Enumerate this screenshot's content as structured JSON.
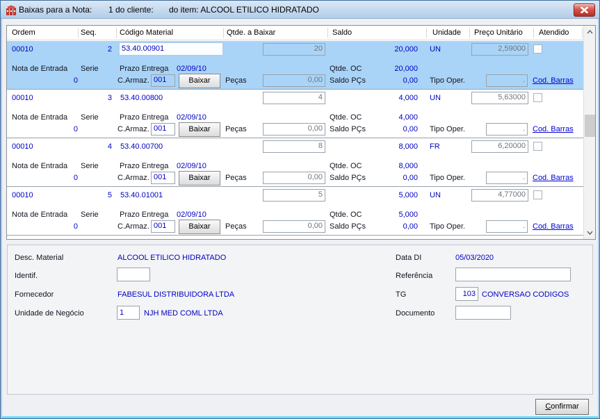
{
  "window": {
    "title_part1": "Baixas para a Nota:",
    "title_part2": "1 do cliente:",
    "title_part3": "do item: ALCOOL ETILICO HIDRATADO"
  },
  "colors": {
    "selected_row": "#a9d4f7",
    "value_text": "#0000c0",
    "link": "#0000d6",
    "titlebar": "#b2cde9",
    "close_button": "#c23b32"
  },
  "table": {
    "headers": [
      "Ordem",
      "Seq.",
      "Código Material",
      "Qtde. a  Baixar",
      "Saldo",
      "Unidade",
      "Preço Unitário",
      "Atendido"
    ],
    "labels": {
      "nota": "Nota de Entrada",
      "serie": "Serie",
      "prazo": "Prazo Entrega",
      "qtde_oc": "Qtde. OC",
      "c_armaz": "C.Armaz.",
      "baixar": "Baixar",
      "pecas": "Peças",
      "saldo_pcs": "Saldo PÇs",
      "tipo_oper": "Tipo Oper.",
      "cod_barras": "Cod. Barras"
    },
    "rows": [
      {
        "selected": true,
        "ordem": "00010",
        "seq": "2",
        "codigo": "53.40.00901",
        "qtde": "20",
        "saldo": "20,000",
        "unidade": "UN",
        "preco": "2,59000",
        "prazo_date": "02/09/10",
        "qtde_oc": "20,000",
        "zero": "0",
        "armazem": "001",
        "pecas_val": "0,00",
        "saldo_pcs_val": "0,00",
        "tipo_val": "."
      },
      {
        "selected": false,
        "ordem": "00010",
        "seq": "3",
        "codigo": "53.40.00800",
        "qtde": "4",
        "saldo": "4,000",
        "unidade": "UN",
        "preco": "5,63000",
        "prazo_date": "02/09/10",
        "qtde_oc": "4,000",
        "zero": "0",
        "armazem": "001",
        "pecas_val": "0,00",
        "saldo_pcs_val": "0,00",
        "tipo_val": "."
      },
      {
        "selected": false,
        "ordem": "00010",
        "seq": "4",
        "codigo": "53.40.00700",
        "qtde": "8",
        "saldo": "8,000",
        "unidade": "FR",
        "preco": "6,20000",
        "prazo_date": "02/09/10",
        "qtde_oc": "8,000",
        "zero": "0",
        "armazem": "001",
        "pecas_val": "0,00",
        "saldo_pcs_val": "0,00",
        "tipo_val": "."
      },
      {
        "selected": false,
        "ordem": "00010",
        "seq": "5",
        "codigo": "53.40.01001",
        "qtde": "5",
        "saldo": "5,000",
        "unidade": "UN",
        "preco": "4,77000",
        "prazo_date": "02/09/10",
        "qtde_oc": "5,000",
        "zero": "0",
        "armazem": "001",
        "pecas_val": "0,00",
        "saldo_pcs_val": "0,00",
        "tipo_val": "."
      }
    ]
  },
  "details": {
    "desc_material_label": "Desc. Material",
    "desc_material": "ALCOOL ETILICO HIDRATADO",
    "identif_label": "Identif.",
    "identif": "",
    "fornecedor_label": "Fornecedor",
    "fornecedor": "FABESUL DISTRIBUIDORA LTDA",
    "unidade_negocio_label": "Unidade de Negócio",
    "unidade_negocio_code": "1",
    "unidade_negocio_name": "NJH MED COML LTDA",
    "data_di_label": "Data DI",
    "data_di": "05/03/2020",
    "referencia_label": "Referência",
    "referencia": "",
    "tg_label": "TG",
    "tg_code": "103",
    "tg_name": "CONVERSAO CODIGOS",
    "documento_label": "Documento",
    "documento": ""
  },
  "footer": {
    "confirmar": "Confirmar"
  }
}
